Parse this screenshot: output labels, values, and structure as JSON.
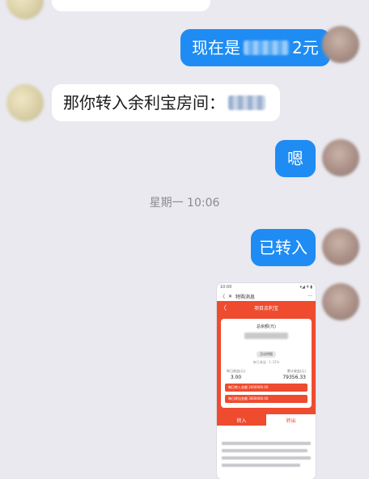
{
  "messages": [
    {
      "side": "self",
      "prefix": "现在是",
      "suffix": "2元"
    },
    {
      "side": "other",
      "prefix": "那你转入余利宝房间："
    },
    {
      "side": "self",
      "text": "嗯"
    },
    {
      "side": "self",
      "text": "已转入"
    }
  ],
  "timestamp": "星期一 10:06",
  "screenshot": {
    "status_time": "10:00",
    "status_right": "▾◢ 4 ▮",
    "nav_back": "〈",
    "nav_close": "✕",
    "nav_title": "特购消息",
    "nav_more": "···",
    "page_title": "项目余利宝",
    "page_back": "〈",
    "panel_title": "总余额(元)",
    "badge": "活动明细",
    "sub": "每日收益 · 1.33%",
    "col1_label": "昨日收益(元)",
    "col1_value": "3.00",
    "col2_label": "累计收益(元)",
    "col2_value": "79356.33",
    "line1": "每日转入金额 2000000.00",
    "line2": "每日转出金额 3600000.00",
    "btn_in": "转入",
    "btn_out": "转出"
  },
  "colors": {
    "background": "#e9e9ef",
    "self_bubble": "#1e8cf3",
    "other_bubble": "#ffffff",
    "accent_red": "#ef4b2f"
  }
}
